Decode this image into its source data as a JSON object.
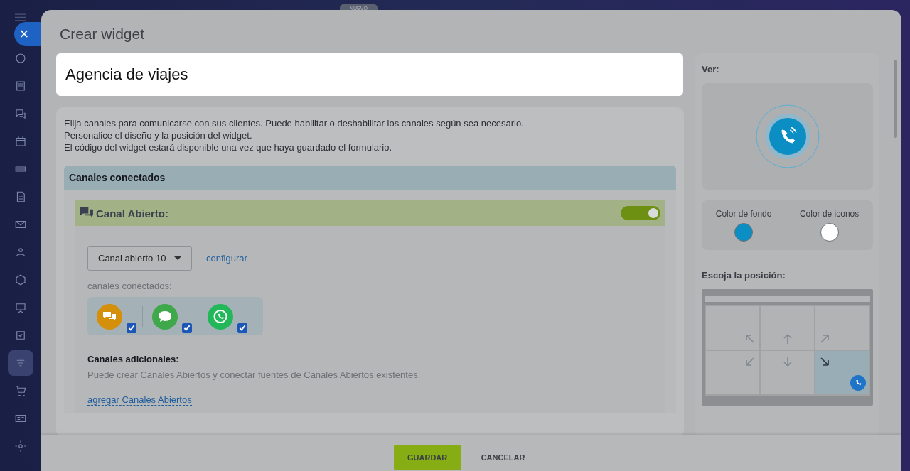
{
  "top_badge": "NUEVO",
  "sidebar": {
    "items": [
      {
        "selected": false
      },
      {
        "selected": false
      },
      {
        "selected": false
      },
      {
        "selected": false
      },
      {
        "selected": false
      },
      {
        "selected": false
      },
      {
        "selected": false
      },
      {
        "selected": false
      },
      {
        "selected": false
      },
      {
        "selected": false
      },
      {
        "selected": false
      },
      {
        "selected": true
      },
      {
        "selected": false
      },
      {
        "selected": false
      },
      {
        "selected": false
      }
    ]
  },
  "close_button": "×",
  "window": {
    "title": "Crear widget"
  },
  "name_field": {
    "value": "Agencia de viajes"
  },
  "description": [
    "Elija canales para comunicarse con sus clientes. Puede habilitar o deshabilitar los canales según sea necesario.",
    "Personalice el diseño y la posición del widget.",
    "El código del widget estará disponible una vez que haya guardado el formulario."
  ],
  "connected": {
    "title": "Canales conectados",
    "open_channel": {
      "title": "Canal Abierto:",
      "on": true,
      "select": "Canal abierto 10",
      "configure": "configurar",
      "channels_label": "canales conectados:",
      "channels": [
        {
          "color": "#d4900a",
          "checked": true
        },
        {
          "color": "#3fa84a",
          "checked": true
        },
        {
          "color": "#22b85a",
          "checked": true
        }
      ],
      "extra_title": "Canales adicionales:",
      "extra_text": "Puede crear Canales Abiertos y conectar fuentes de Canales Abiertos existentes.",
      "extra_link": "agregar Canales Abiertos"
    }
  },
  "preview": {
    "title": "Ver:",
    "colors": [
      {
        "label": "Color de fondo",
        "color": "#0b8ec4"
      },
      {
        "label": "Color de iconos",
        "color": "#ffffff"
      }
    ],
    "position_title": "Escoja la posición:",
    "positions": [
      {
        "selected": false
      },
      {
        "selected": false
      },
      {
        "selected": false
      },
      {
        "selected": false
      },
      {
        "selected": false
      },
      {
        "selected": true
      }
    ]
  },
  "buttons": [
    "GUARDAR",
    "CANCELAR"
  ]
}
